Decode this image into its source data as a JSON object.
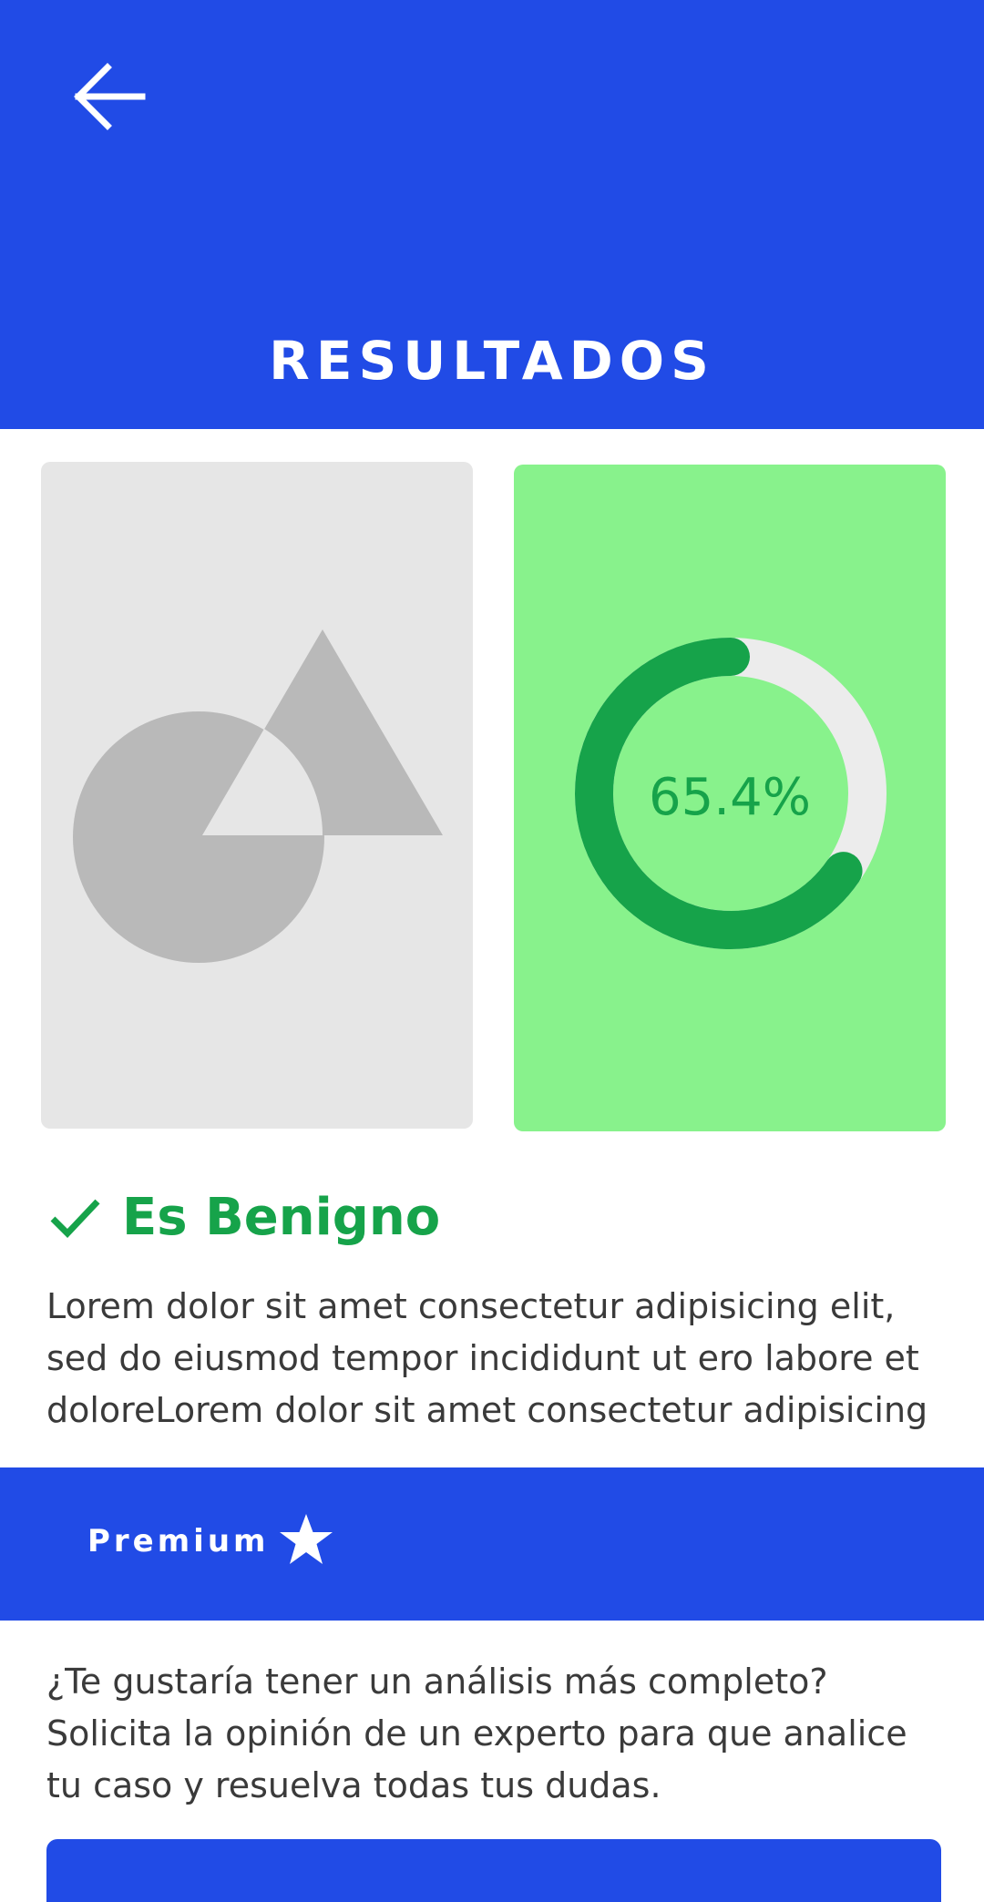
{
  "header": {
    "title": "RESULTADOS",
    "back_icon": "arrow-left-icon"
  },
  "image_card": {
    "icon": "image-placeholder-icon"
  },
  "result": {
    "percentage": 65.4,
    "percentage_label": "65.4%",
    "track_color": "#ececec",
    "progress_color": "#16a34a",
    "card_color": "#88f28c"
  },
  "verdict": {
    "icon": "check-icon",
    "text": "Es Benigno"
  },
  "description": "Lorem dolor sit amet consectetur adipisicing elit, sed do eiusmod tempor incididunt ut ero labore et doloreLorem dolor sit amet consectetur adipisicing",
  "premium": {
    "label": "Premium",
    "icon": "star-icon"
  },
  "promo_text": "¿Te gustaría tener un análisis más completo? Solicita la opinión de un experto para que analice tu caso y resuelva todas tus dudas.",
  "colors": {
    "primary": "#214be6",
    "success": "#16a34a"
  }
}
